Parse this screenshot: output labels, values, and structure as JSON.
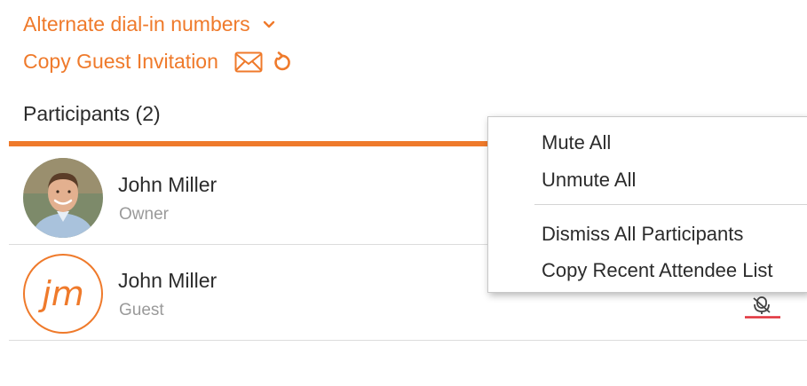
{
  "links": {
    "dial_in_label": "Alternate dial-in numbers",
    "copy_invite_label": "Copy Guest Invitation"
  },
  "participants": {
    "title": "Participants (2)",
    "items": [
      {
        "name": "John Miller",
        "role": "Owner",
        "avatar": "photo"
      },
      {
        "name": "John Miller",
        "role": "Guest",
        "initials": "jm"
      }
    ]
  },
  "context_menu": {
    "items": [
      {
        "label": "Mute All"
      },
      {
        "label": "Unmute All"
      },
      {
        "label": "Dismiss All Participants"
      },
      {
        "label": "Copy Recent Attendee List"
      }
    ]
  },
  "icons": {
    "dial_in": "chevron-down-icon",
    "invite_email": "envelope-icon",
    "invite_refresh": "refresh-icon",
    "guest_audio": "microphone-muted-icon"
  },
  "colors": {
    "accent": "#ef7a2b",
    "text": "#2b2b2b",
    "muted_text": "#9a9a9a",
    "mute_indicator": "#e0303a"
  }
}
